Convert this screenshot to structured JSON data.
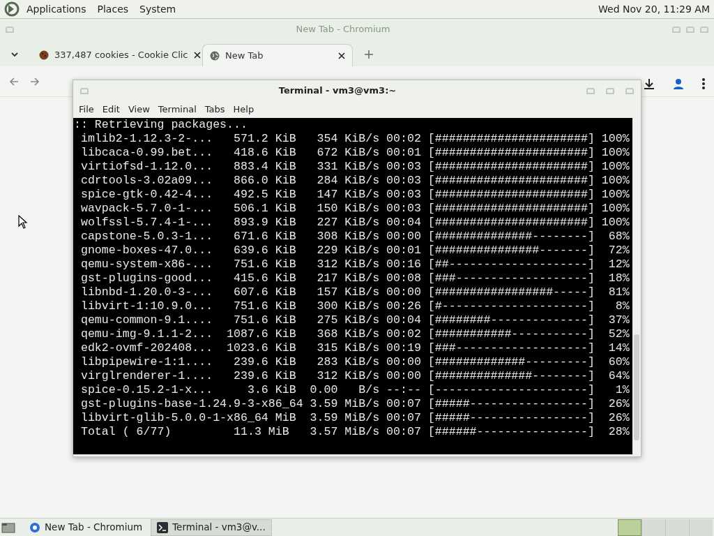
{
  "top_panel": {
    "menus": [
      "Applications",
      "Places",
      "System"
    ],
    "clock": "Wed Nov 20, 11:29 AM"
  },
  "browser": {
    "title": "New Tab - Chromium",
    "tabs": [
      {
        "label": "337,487 cookies - Cookie Clic",
        "selected": false,
        "kind": "cookie"
      },
      {
        "label": "New Tab",
        "selected": true,
        "kind": "globe"
      }
    ]
  },
  "terminal": {
    "title": "Terminal - vm3@vm3:~",
    "menu": [
      "File",
      "Edit",
      "View",
      "Terminal",
      "Tabs",
      "Help"
    ],
    "lines": [
      ":: Retrieving packages...",
      " imlib2-1.12.3-2-...   571.2 KiB   354 KiB/s 00:02 [######################] 100%",
      " libcaca-0.99.bet...   418.6 KiB   672 KiB/s 00:01 [######################] 100%",
      " virtiofsd-1.12.0...   883.4 KiB   331 KiB/s 00:03 [######################] 100%",
      " cdrtools-3.02a09...   866.0 KiB   284 KiB/s 00:03 [######################] 100%",
      " spice-gtk-0.42-4...   492.5 KiB   147 KiB/s 00:03 [######################] 100%",
      " wavpack-5.7.0-1-...   506.1 KiB   150 KiB/s 00:03 [######################] 100%",
      " wolfssl-5.7.4-1-...   893.9 KiB   227 KiB/s 00:04 [######################] 100%",
      " capstone-5.0.3-1...   671.6 KiB   308 KiB/s 00:00 [##############--------]  68%",
      " gnome-boxes-47.0...   639.6 KiB   229 KiB/s 00:01 [###############-------]  72%",
      " qemu-system-x86-...   751.6 KiB   312 KiB/s 00:16 [##--------------------]  12%",
      " gst-plugins-good...   415.6 KiB   217 KiB/s 00:08 [###-------------------]  18%",
      " libnbd-1.20.0-3-...   607.6 KiB   157 KiB/s 00:00 [#################-----]  81%",
      " libvirt-1:10.9.0...   751.6 KiB   300 KiB/s 00:26 [#---------------------]   8%",
      " qemu-common-9.1....   751.6 KiB   275 KiB/s 00:04 [########--------------]  37%",
      " qemu-img-9.1.1-2...  1087.6 KiB   368 KiB/s 00:02 [###########-----------]  52%",
      " edk2-ovmf-202408...  1023.6 KiB   315 KiB/s 00:19 [###-------------------]  14%",
      " libpipewire-1:1....   239.6 KiB   283 KiB/s 00:00 [#############---------]  60%",
      " virglrenderer-1....   239.6 KiB   312 KiB/s 00:00 [##############--------]  64%",
      " spice-0.15.2-1-x...     3.6 KiB  0.00   B/s --:-- [----------------------]   1%",
      " gst-plugins-base-1.24.9-3-x86_64 3.59 MiB/s 00:07 [#####-----------------]  26%",
      " libvirt-glib-5.0.0-1-x86_64 MiB  3.59 MiB/s 00:07 [#####-----------------]  26%",
      " Total ( 6/77)         11.3 MiB   3.57 MiB/s 00:07 [######----------------]  28%"
    ]
  },
  "taskbar": {
    "items": [
      {
        "label": "New Tab - Chromium",
        "selected": false,
        "kind": "browser"
      },
      {
        "label": "Terminal - vm3@v...",
        "selected": true,
        "kind": "terminal"
      }
    ],
    "workspaces": [
      {
        "selected": true
      },
      {
        "selected": false
      },
      {
        "selected": false
      },
      {
        "selected": false
      }
    ]
  }
}
